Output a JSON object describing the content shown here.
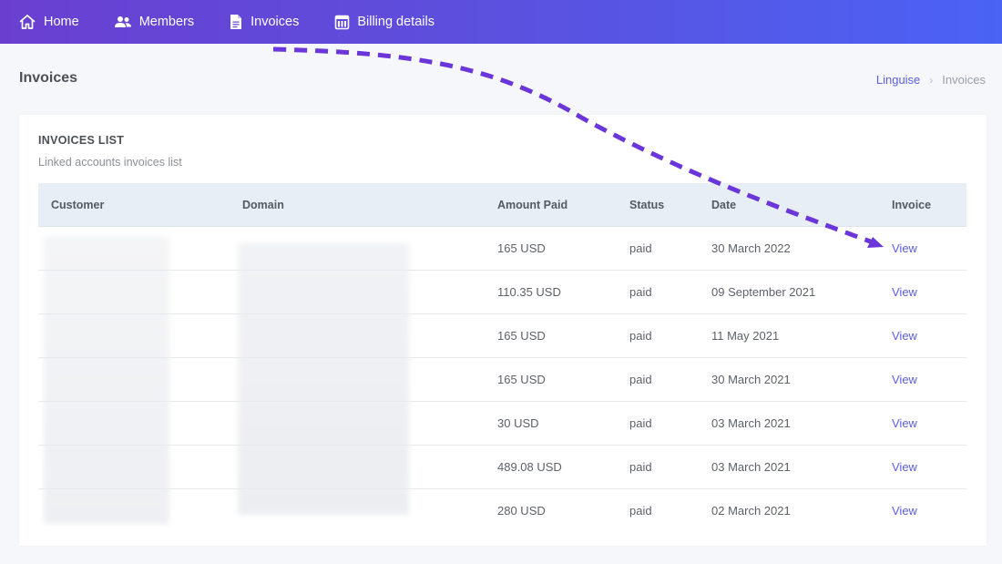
{
  "nav": {
    "items": [
      {
        "label": "Home",
        "icon": "home-icon"
      },
      {
        "label": "Members",
        "icon": "members-icon"
      },
      {
        "label": "Invoices",
        "icon": "document-icon"
      },
      {
        "label": "Billing details",
        "icon": "billing-icon"
      }
    ]
  },
  "page": {
    "title": "Invoices"
  },
  "breadcrumb": {
    "link": "Linguise",
    "current": "Invoices"
  },
  "card": {
    "title": "INVOICES LIST",
    "subtitle": "Linked accounts invoices list"
  },
  "table": {
    "headers": [
      "Customer",
      "Domain",
      "Amount Paid",
      "Status",
      "Date",
      "Invoice"
    ],
    "rows": [
      {
        "amount": "165 USD",
        "status": "paid",
        "date": "30 March 2022",
        "invoice": "View"
      },
      {
        "amount": "110.35 USD",
        "status": "paid",
        "date": "09 September 2021",
        "invoice": "View"
      },
      {
        "amount": "165 USD",
        "status": "paid",
        "date": "11 May 2021",
        "invoice": "View"
      },
      {
        "amount": "165 USD",
        "status": "paid",
        "date": "30 March 2021",
        "invoice": "View"
      },
      {
        "amount": "30 USD",
        "status": "paid",
        "date": "03 March 2021",
        "invoice": "View"
      },
      {
        "amount": "489.08 USD",
        "status": "paid",
        "date": "03 March 2021",
        "invoice": "View"
      },
      {
        "amount": "280 USD",
        "status": "paid",
        "date": "02 March 2021",
        "invoice": "View"
      }
    ]
  },
  "colors": {
    "nav_gradient_start": "#6a3fd0",
    "nav_gradient_end": "#4a63f5",
    "link": "#5b5fe0",
    "annotation_arrow": "#6a35d9"
  }
}
